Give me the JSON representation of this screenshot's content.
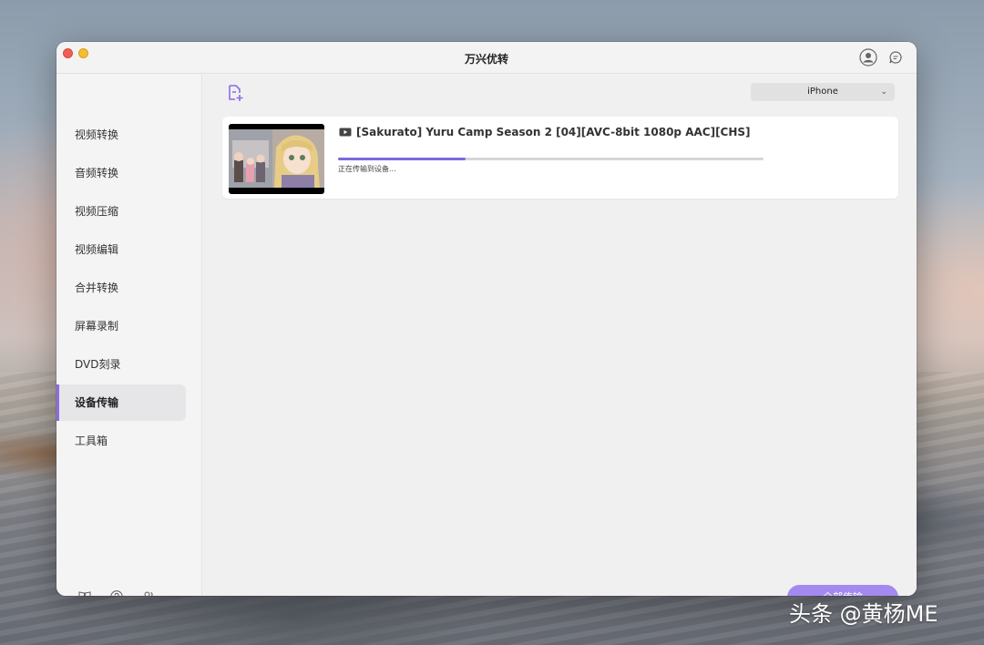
{
  "app": {
    "title": "万兴优转"
  },
  "sidebar": {
    "items": [
      {
        "label": "视频转换",
        "icon": ""
      },
      {
        "label": "音频转换",
        "icon": ""
      },
      {
        "label": "视频压缩",
        "icon": ""
      },
      {
        "label": "视频编辑",
        "icon": ""
      },
      {
        "label": "合并转换",
        "icon": ""
      },
      {
        "label": "屏幕录制",
        "icon": ""
      },
      {
        "label": "DVD刻录",
        "icon": ""
      },
      {
        "label": "设备传输",
        "icon": "",
        "active": true
      },
      {
        "label": "工具箱",
        "icon": ""
      }
    ],
    "bottom_icons": [
      "book-icon",
      "help-icon",
      "users-icon"
    ]
  },
  "toolbar": {
    "add_file_icon": "add-file-icon",
    "device_selected": "iPhone"
  },
  "files": [
    {
      "name": "[Sakurato] Yuru Camp Season 2 [04][AVC-8bit 1080p AAC][CHS]",
      "status": "正在传输到设备...",
      "progress": 0.3
    }
  ],
  "footer": {
    "transfer_all_label": "全部传输"
  },
  "watermark": "头条 @黄杨ME",
  "colors": {
    "accent": "#8d6be6",
    "button": "#a48af0",
    "progress": "#7f68dc",
    "close": "#ee5f57",
    "minimize": "#f5bd30"
  }
}
